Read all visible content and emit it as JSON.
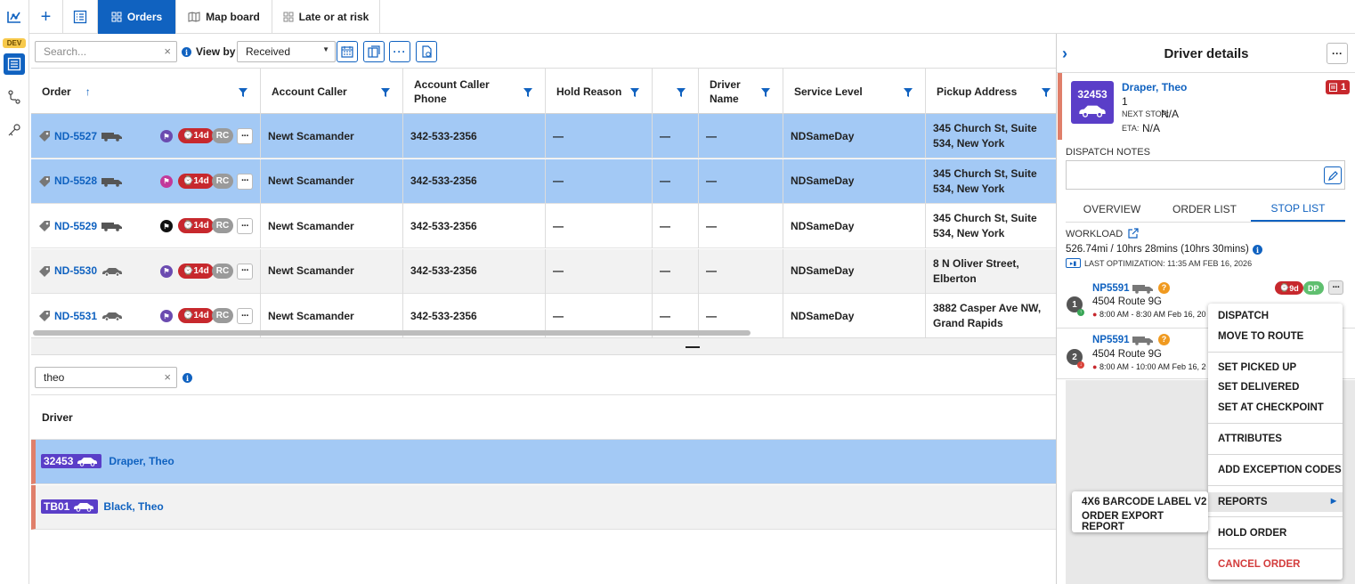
{
  "rail": {
    "dev_badge": "DEV"
  },
  "tabs": [
    {
      "label": "Orders"
    },
    {
      "label": "Map board"
    },
    {
      "label": "Late or at risk"
    }
  ],
  "toolbar": {
    "search_placeholder": "Search...",
    "view_by_label": "View by",
    "view_by_value": "Received"
  },
  "grid": {
    "columns": [
      "Order",
      "Account Caller",
      "Account Caller Phone",
      "Hold Reason",
      "",
      "Driver Name",
      "Service Level",
      "Pickup Address"
    ],
    "rows": [
      {
        "order": "ND-5527",
        "age": "14d",
        "code": "RC",
        "caller": "Newt Scamander",
        "phone": "342-533-2356",
        "hold": "—",
        "blank": "—",
        "driver": "—",
        "service": "NDSameDay",
        "pickup": "345 Church St, Suite 534, New York",
        "flag_color": "#6b4bb0"
      },
      {
        "order": "ND-5528",
        "age": "14d",
        "code": "RC",
        "caller": "Newt Scamander",
        "phone": "342-533-2356",
        "hold": "—",
        "blank": "—",
        "driver": "—",
        "service": "NDSameDay",
        "pickup": "345 Church St, Suite 534, New York",
        "flag_color": "#c2399a"
      },
      {
        "order": "ND-5529",
        "age": "14d",
        "code": "RC",
        "caller": "Newt Scamander",
        "phone": "342-533-2356",
        "hold": "—",
        "blank": "—",
        "driver": "—",
        "service": "NDSameDay",
        "pickup": "345 Church St, Suite 534, New York",
        "flag_color": "#111111"
      },
      {
        "order": "ND-5530",
        "age": "14d",
        "code": "RC",
        "caller": "Newt Scamander",
        "phone": "342-533-2356",
        "hold": "—",
        "blank": "—",
        "driver": "—",
        "service": "NDSameDay",
        "pickup": "8 N Oliver Street, Elberton",
        "flag_color": "#6b4bb0"
      },
      {
        "order": "ND-5531",
        "age": "14d",
        "code": "RC",
        "caller": "Newt Scamander",
        "phone": "342-533-2356",
        "hold": "—",
        "blank": "—",
        "driver": "—",
        "service": "NDSameDay",
        "pickup": "3882 Casper Ave NW, Grand Rapids",
        "flag_color": "#6b4bb0"
      }
    ]
  },
  "driver_search": {
    "value": "theo"
  },
  "driver_list": {
    "header": "Driver",
    "rows": [
      {
        "tag": "32453",
        "name": "Draper, Theo"
      },
      {
        "tag": "TB01",
        "name": "Black, Theo"
      }
    ]
  },
  "panel": {
    "title": "Driver details",
    "driver_tag": "32453",
    "driver_name": "Draper, Theo",
    "driver_line2": "1",
    "next_stop_label": "NEXT STOP:",
    "next_stop_value": "N/A",
    "eta_label": "ETA:",
    "eta_value": "N/A",
    "count_badge": "1",
    "dispatch_notes_label": "DISPATCH NOTES",
    "tabs": [
      "OVERVIEW",
      "ORDER LIST",
      "STOP LIST"
    ],
    "workload_label": "WORKLOAD",
    "workload_value": "526.74mi / 10hrs 28mins (10hrs 30mins)",
    "last_opt": "LAST OPTIMIZATION: 11:35 AM FEB 16, 2026",
    "stops": [
      {
        "num": "1",
        "order": "NP5591",
        "address": "4504 Route 9G",
        "time": "8:00 AM - 8:30 AM Feb 16, 2026",
        "age": "9d",
        "code": "DP"
      },
      {
        "num": "2",
        "order": "NP5591",
        "address": "4504 Route 9G",
        "time": "8:00 AM - 10:00 AM Feb 16, 2026"
      }
    ]
  },
  "context_menu": {
    "items": [
      "DISPATCH",
      "MOVE TO ROUTE",
      "SET PICKED UP",
      "SET DELIVERED",
      "SET AT CHECKPOINT",
      "ATTRIBUTES",
      "ADD EXCEPTION CODES",
      "REPORTS",
      "HOLD ORDER",
      "CANCEL ORDER"
    ]
  },
  "submenu": {
    "items": [
      "4X6 BARCODE LABEL V2",
      "ORDER EXPORT REPORT"
    ]
  },
  "colors": {
    "primary": "#1062c0",
    "selected_row": "#a3c9f5",
    "danger": "#c7282d",
    "driver_tag": "#5a3ec8"
  }
}
